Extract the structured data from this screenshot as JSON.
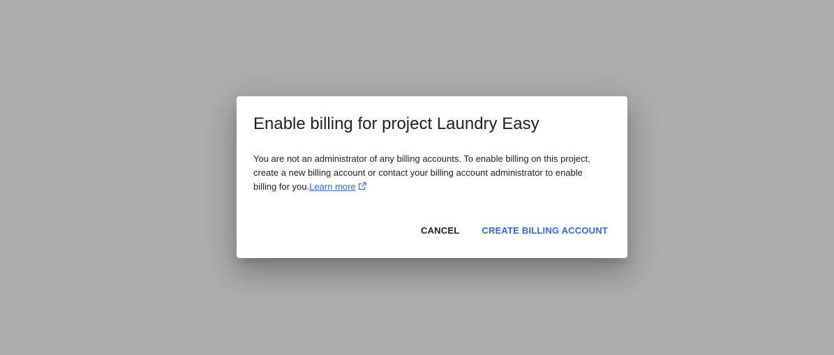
{
  "dialog": {
    "title": "Enable billing for project Laundry Easy",
    "body_text": "You are not an administrator of any billing accounts. To enable billing on this project, create a new billing account or contact your billing account administrator to enable billing for you.",
    "learn_more_label": "Learn more",
    "learn_more_icon": "open-in-new-icon",
    "cancel_label": "CANCEL",
    "create_label": "CREATE BILLING ACCOUNT"
  },
  "colors": {
    "scrim": "#adadad",
    "accent": "#3367d6",
    "text": "#202124"
  }
}
